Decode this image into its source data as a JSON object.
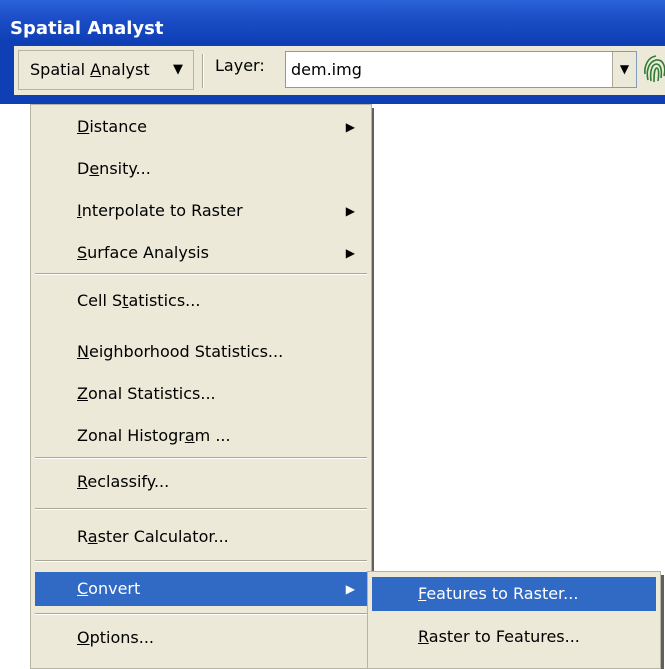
{
  "window": {
    "title": "Spatial Analyst"
  },
  "toolbar": {
    "menu_label": "Spatial Analyst",
    "layer_label": "Layer:",
    "layer_value": "dem.img"
  },
  "menu": {
    "items": [
      {
        "label": "Distance",
        "has_submenu": true
      },
      {
        "label": "Density...",
        "has_submenu": false
      },
      {
        "label": "Interpolate to Raster",
        "has_submenu": true
      },
      {
        "label": "Surface Analysis",
        "has_submenu": true
      },
      {
        "label": "Cell Statistics...",
        "has_submenu": false
      },
      {
        "label": "Neighborhood Statistics...",
        "has_submenu": false
      },
      {
        "label": "Zonal Statistics...",
        "has_submenu": false
      },
      {
        "label": "Zonal Histogram ...",
        "has_submenu": false
      },
      {
        "label": "Reclassify...",
        "has_submenu": false
      },
      {
        "label": "Raster Calculator...",
        "has_submenu": false
      },
      {
        "label": "Convert",
        "has_submenu": true,
        "highlighted": true
      },
      {
        "label": "Options...",
        "has_submenu": false
      }
    ]
  },
  "submenu": {
    "items": [
      {
        "label": "Features to Raster...",
        "highlighted": true
      },
      {
        "label": "Raster to Features...",
        "highlighted": false
      }
    ]
  },
  "colors": {
    "highlight": "#316ac5",
    "titlebar": "#0e3fb5",
    "menu_bg": "#ece9d8"
  }
}
